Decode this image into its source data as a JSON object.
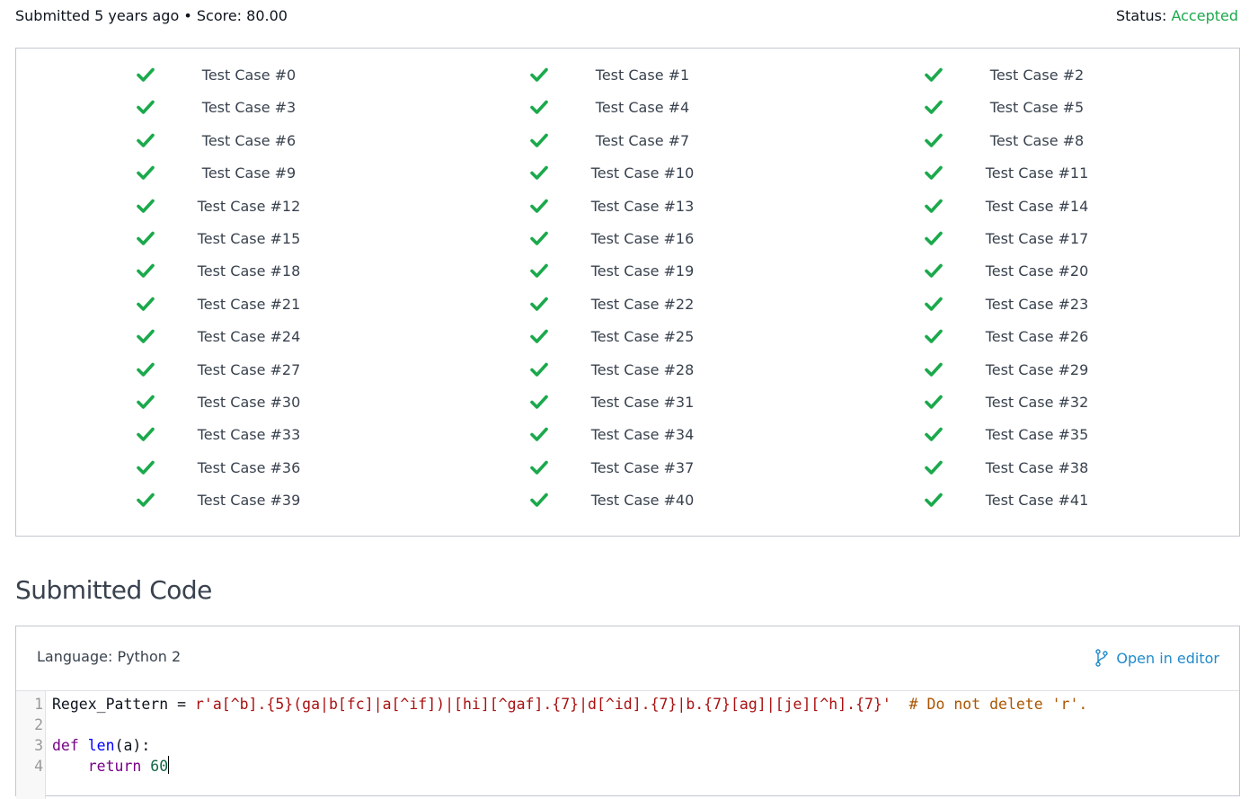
{
  "header": {
    "submitted_text": "Submitted 5 years ago • Score: 80.00",
    "status_label": "Status: ",
    "status_value": "Accepted"
  },
  "colors": {
    "accent_green": "#1ba94c",
    "link_blue": "#1f8acb"
  },
  "test_cases": [
    "Test Case #0",
    "Test Case #1",
    "Test Case #2",
    "Test Case #3",
    "Test Case #4",
    "Test Case #5",
    "Test Case #6",
    "Test Case #7",
    "Test Case #8",
    "Test Case #9",
    "Test Case #10",
    "Test Case #11",
    "Test Case #12",
    "Test Case #13",
    "Test Case #14",
    "Test Case #15",
    "Test Case #16",
    "Test Case #17",
    "Test Case #18",
    "Test Case #19",
    "Test Case #20",
    "Test Case #21",
    "Test Case #22",
    "Test Case #23",
    "Test Case #24",
    "Test Case #25",
    "Test Case #26",
    "Test Case #27",
    "Test Case #28",
    "Test Case #29",
    "Test Case #30",
    "Test Case #31",
    "Test Case #32",
    "Test Case #33",
    "Test Case #34",
    "Test Case #35",
    "Test Case #36",
    "Test Case #37",
    "Test Case #38",
    "Test Case #39",
    "Test Case #40",
    "Test Case #41"
  ],
  "test_case_status_icon": "check-icon",
  "section": {
    "title": "Submitted Code"
  },
  "code_panel": {
    "language_label": "Language: Python 2",
    "open_editor_label": "Open in editor",
    "open_editor_icon": "branch-icon",
    "lines": [
      {
        "number": "1",
        "segments": [
          {
            "t": "Regex_Pattern = ",
            "c": ""
          },
          {
            "t": "r'a[^b].{5}(ga|b[fc]|a[^if])|[hi][^gaf].{7}|d[^id].{7}|b.{7}[ag]|[je][^h].{7}'",
            "c": "str"
          },
          {
            "t": "  ",
            "c": ""
          },
          {
            "t": "# Do not delete 'r'.",
            "c": "cm"
          }
        ]
      },
      {
        "number": "2",
        "segments": []
      },
      {
        "number": "3",
        "segments": [
          {
            "t": "def",
            "c": "kw"
          },
          {
            "t": " ",
            "c": ""
          },
          {
            "t": "len",
            "c": "fn"
          },
          {
            "t": "(a):",
            "c": ""
          }
        ]
      },
      {
        "number": "4",
        "segments": [
          {
            "t": "    ",
            "c": ""
          },
          {
            "t": "return",
            "c": "kw"
          },
          {
            "t": " ",
            "c": ""
          },
          {
            "t": "60",
            "c": "num"
          }
        ]
      }
    ]
  }
}
